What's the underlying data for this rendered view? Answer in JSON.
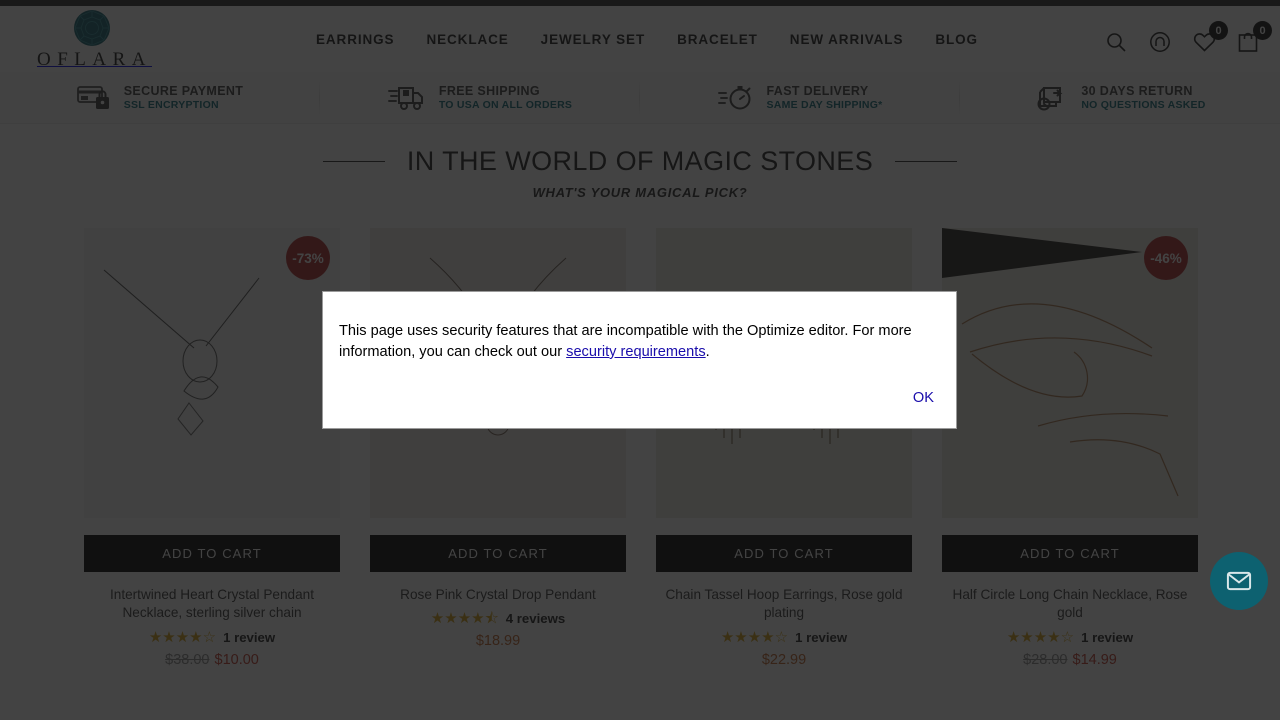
{
  "header": {
    "brand_name": "OFLARA",
    "brand_logo_icon": "gem-logo-icon",
    "nav": [
      {
        "label": "EARRINGS"
      },
      {
        "label": "NECKLACE"
      },
      {
        "label": "JEWELRY SET"
      },
      {
        "label": "BRACELET"
      },
      {
        "label": "NEW ARRIVALS"
      },
      {
        "label": "BLOG"
      }
    ],
    "icons": {
      "search": "search-icon",
      "account": "account-icon",
      "wishlist": "heart-icon",
      "cart": "shopping-bag-icon"
    },
    "wishlist_count": "0",
    "cart_count": "0"
  },
  "trust_bar": [
    {
      "icon": "credit-card-lock-icon",
      "title": "SECURE PAYMENT",
      "subtitle": "SSL ENCRYPTION"
    },
    {
      "icon": "delivery-truck-icon",
      "title": "FREE SHIPPING",
      "subtitle": "TO USA ON ALL ORDERS"
    },
    {
      "icon": "stopwatch-icon",
      "title": "FAST DELIVERY",
      "subtitle": "SAME DAY SHIPPING*"
    },
    {
      "icon": "return-box-icon",
      "title": "30 DAYS RETURN",
      "subtitle": "NO QUESTIONS ASKED"
    }
  ],
  "section": {
    "title": "IN THE WORLD OF MAGIC STONES",
    "subtitle": "WHAT'S YOUR MAGICAL PICK?"
  },
  "products": [
    {
      "title": "Intertwined Heart Crystal Pendant Necklace, sterling silver chain",
      "badge": "-73%",
      "stars": "★★★★☆",
      "reviews": "1 review",
      "price_old": "$38.00",
      "price_new": "$10.00",
      "add_to_cart": "ADD TO CART"
    },
    {
      "title": "Rose Pink Crystal Drop Pendant",
      "badge": "",
      "stars": "★★★★⯪",
      "reviews": "4 reviews",
      "price_old": "",
      "price_new": "$18.99",
      "add_to_cart": "ADD TO CART"
    },
    {
      "title": "Chain Tassel Hoop Earrings, Rose gold plating",
      "badge": "",
      "stars": "★★★★☆",
      "reviews": "1 review",
      "price_old": "",
      "price_new": "$22.99",
      "add_to_cart": "ADD TO CART"
    },
    {
      "title": "Half Circle Long Chain Necklace, Rose gold",
      "badge": "-46%",
      "stars": "★★★★☆",
      "reviews": "1 review",
      "price_old": "$28.00",
      "price_new": "$14.99",
      "add_to_cart": "ADD TO CART"
    }
  ],
  "chat": {
    "icon": "envelope-icon"
  },
  "alert": {
    "message_before_link": "This page uses security features that are incompatible with the Optimize editor. For more information, you can check out our ",
    "link_text": "security requirements",
    "message_after_link": ".",
    "ok_label": "OK"
  },
  "colors": {
    "brand_teal": "#0f6b78",
    "badge_red": "#b02b2b",
    "sale_price": "#c0392b",
    "link_blue": "#1a0dab",
    "star_gold": "#d4a017"
  }
}
